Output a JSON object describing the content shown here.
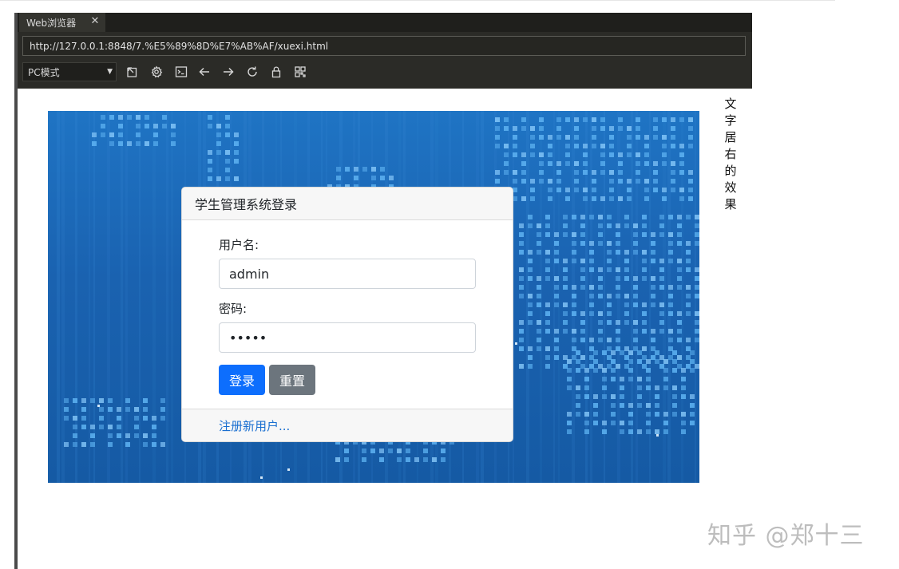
{
  "browser": {
    "tab_title": "Web浏览器",
    "tab_close": "✕",
    "url": "http://127.0.0.1:8848/7.%E5%89%8D%E7%AB%AF/xuexi.html",
    "mode": "PC模式",
    "toolbar_icons": [
      "open-external-icon",
      "settings-icon",
      "console-icon",
      "back-arrow-icon",
      "forward-arrow-icon",
      "reload-icon",
      "lock-icon",
      "qr-code-icon"
    ]
  },
  "page": {
    "side_text": [
      "文",
      "字",
      "居",
      "右",
      "的",
      "效",
      "果"
    ],
    "login": {
      "title": "学生管理系统登录",
      "username_label": "用户名:",
      "username_value": "admin",
      "password_label": "密码:",
      "password_value": "•••••",
      "login_button": "登录",
      "reset_button": "重置",
      "register_link": "注册新用户..."
    }
  },
  "watermark": "知乎 @郑十三",
  "colors": {
    "primary": "#0d6efd",
    "secondary": "#6c757d",
    "hero_blue": "#1a62b0",
    "link": "#1a6fd0"
  }
}
